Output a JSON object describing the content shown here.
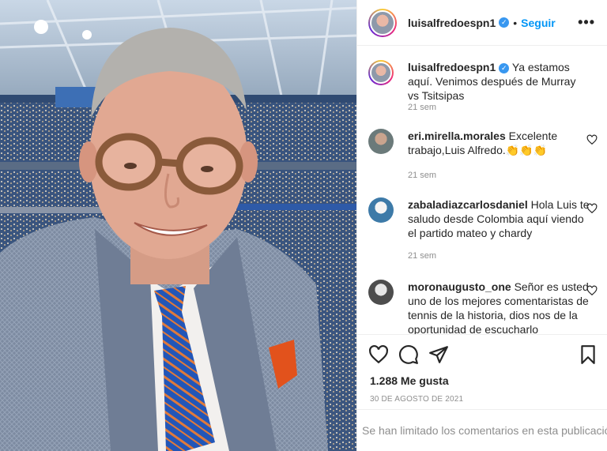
{
  "post": {
    "username": "luisalfredoespn1",
    "follow_label": "Seguir",
    "separator": "•",
    "more_label": "•••",
    "caption": {
      "username": "luisalfredoespn1",
      "text": "Ya estamos aquí. Venimos después de Murray vs Tsitsipas",
      "time": "21 sem"
    },
    "comments": [
      {
        "username": "eri.mirella.morales",
        "text": "Excelente trabajo,Luis Alfredo.👏👏👏",
        "time": "21 sem"
      },
      {
        "username": "zabaladiazcarlosdaniel",
        "text": "Hola Luis te saludo desde Colombia aquí viendo el partido mateo y chardy",
        "time": "21 sem"
      },
      {
        "username": "moronaugusto_one",
        "text": "Señor es usted uno de los mejores comentaristas de tennis de la historia, dios nos de la oportunidad de escucharlo",
        "time": ""
      }
    ],
    "likes": "1.288 Me gusta",
    "date": "30 DE AGOSTO DE 2021",
    "comments_limited": "Se han limitado los comentarios en esta publicación."
  },
  "icons": {
    "verified": "verified-badge-icon",
    "like": "heart-icon",
    "comment": "comment-bubble-icon",
    "share": "paper-plane-icon",
    "save": "bookmark-icon",
    "more": "more-options-icon"
  },
  "colors": {
    "accent": "#0095f6",
    "verified": "#3897f0",
    "muted": "#8e8e8e",
    "text": "#262626",
    "divider": "#efefef"
  }
}
